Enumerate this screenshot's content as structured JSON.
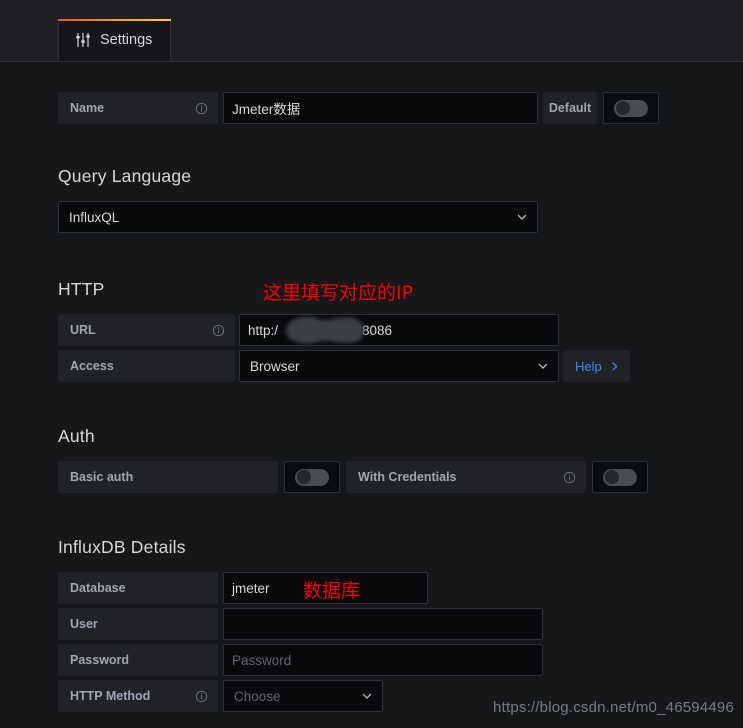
{
  "tab": {
    "label": "Settings",
    "icon": "sliders-icon"
  },
  "name_row": {
    "label": "Name",
    "value": "Jmeter数据",
    "default_label": "Default",
    "default_toggle": "off",
    "info_icon": "info-circle-icon"
  },
  "query_language": {
    "title": "Query Language",
    "value": "InfluxQL",
    "chevron": "chevron-down-icon"
  },
  "http": {
    "title": "HTTP",
    "url": {
      "label": "URL",
      "value_prefix": "http:/",
      "value_suffix": "8086",
      "redacted": true,
      "info_icon": "info-circle-icon"
    },
    "access": {
      "label": "Access",
      "value": "Browser",
      "chevron": "chevron-down-icon"
    },
    "help": {
      "label": "Help",
      "chevron": "chevron-right-icon"
    }
  },
  "auth": {
    "title": "Auth",
    "basic_auth": {
      "label": "Basic auth",
      "toggle": "off"
    },
    "with_credentials": {
      "label": "With Credentials",
      "toggle": "off",
      "info_icon": "info-circle-icon"
    }
  },
  "influxdb": {
    "title": "InfluxDB Details",
    "database": {
      "label": "Database",
      "value": "jmeter"
    },
    "user": {
      "label": "User",
      "value": ""
    },
    "password": {
      "label": "Password",
      "placeholder": "Password",
      "value": ""
    },
    "http_method": {
      "label": "HTTP Method",
      "placeholder": "Choose",
      "info_icon": "info-circle-icon",
      "chevron": "chevron-down-icon"
    }
  },
  "annotations": {
    "ip_note": "这里填写对应的IP",
    "db_note": "数据库"
  },
  "watermark": "https://blog.csdn.net/m0_46594496",
  "colors": {
    "accent_tab": "#f5a623",
    "link": "#3d8bff",
    "annotation": "#ff0000",
    "page_bg": "#161719",
    "input_bg": "#09090b"
  }
}
